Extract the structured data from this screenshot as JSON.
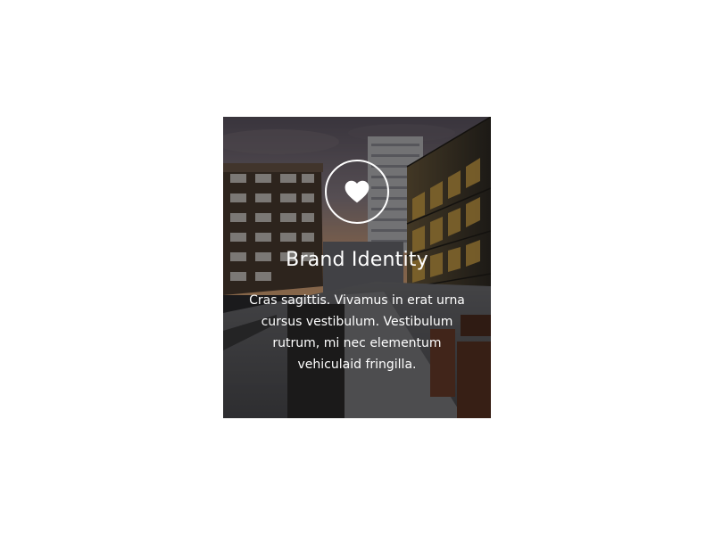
{
  "card": {
    "title": "Brand Identity",
    "description": "Cras sagittis. Vivamus in erat urna cursus vestibulum. Vestibulum rutrum, mi nec elementum vehiculaid fringilla.",
    "icon": "heart-icon"
  },
  "colors": {
    "text": "#ffffff",
    "overlay": "rgba(0,0,0,0.38)"
  }
}
